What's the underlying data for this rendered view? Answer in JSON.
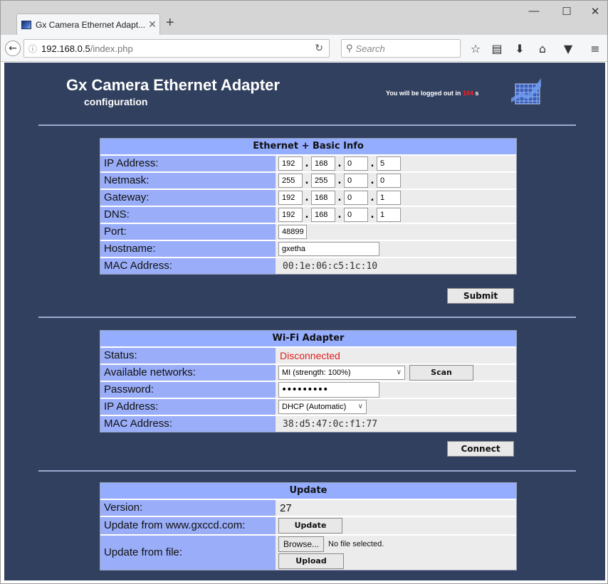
{
  "browser": {
    "tab_title": "Gx Camera Ethernet Adapt...",
    "tab_close": "✕",
    "new_tab": "+",
    "win_min": "—",
    "win_max": "☐",
    "win_close": "✕",
    "url_host": "192.168.0.5",
    "url_path": "/index.php",
    "search_placeholder": "Search",
    "icons": [
      "back-icon",
      "info-icon",
      "reload-icon",
      "search-icon",
      "bookmark-star-icon",
      "reading-list-icon",
      "download-icon",
      "home-icon",
      "pocket-icon",
      "menu-icon"
    ]
  },
  "header": {
    "title": "Gx Camera Ethernet Adapter",
    "subtitle": "configuration",
    "logout_prefix": "You will be logged out in",
    "logout_seconds": "104",
    "logout_suffix": "s"
  },
  "ethernet": {
    "heading": "Ethernet + Basic Info",
    "ip_label": "IP Address:",
    "ip": [
      "192",
      "168",
      "0",
      "5"
    ],
    "netmask_label": "Netmask:",
    "netmask": [
      "255",
      "255",
      "0",
      "0"
    ],
    "gateway_label": "Gateway:",
    "gateway": [
      "192",
      "168",
      "0",
      "1"
    ],
    "dns_label": "DNS:",
    "dns": [
      "192",
      "168",
      "0",
      "1"
    ],
    "port_label": "Port:",
    "port": "48899",
    "hostname_label": "Hostname:",
    "hostname": "gxetha",
    "mac_label": "MAC Address:",
    "mac": "00:1e:06:c5:1c:10",
    "submit": "Submit"
  },
  "wifi": {
    "heading": "Wi-Fi Adapter",
    "status_label": "Status:",
    "status": "Disconnected",
    "networks_label": "Available networks:",
    "network_selected": "MI (strength: 100%)",
    "scan": "Scan",
    "password_label": "Password:",
    "password_mask": "•••••••••",
    "ip_label": "IP Address:",
    "ip_mode": "DHCP (Automatic)",
    "mac_label": "MAC Address:",
    "mac": "38:d5:47:0c:f1:77",
    "connect": "Connect"
  },
  "update": {
    "heading": "Update",
    "version_label": "Version:",
    "version": "27",
    "web_label": "Update from www.gxccd.com:",
    "web_button": "Update",
    "file_label": "Update from file:",
    "browse": "Browse...",
    "no_file": "No file selected.",
    "upload": "Upload"
  }
}
